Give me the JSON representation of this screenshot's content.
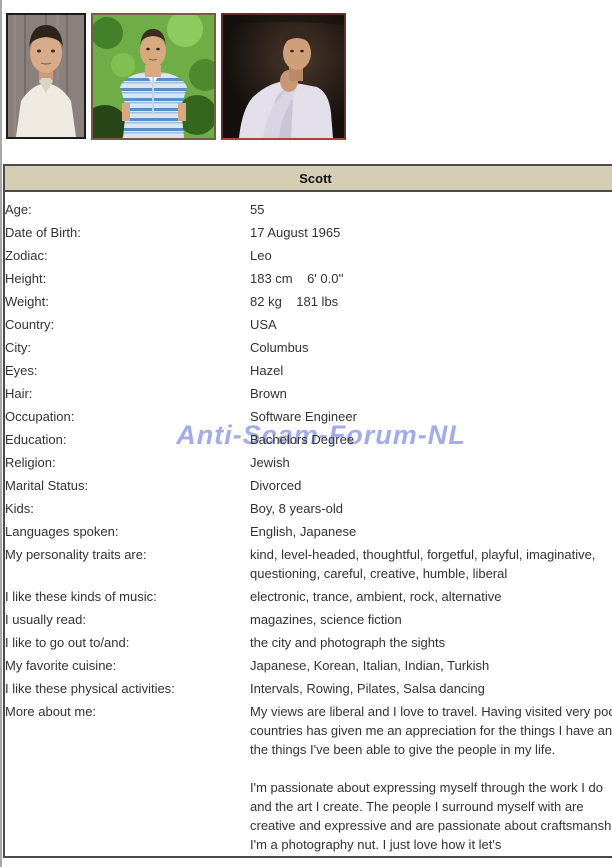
{
  "watermark": {
    "text": "Anti-Scam-Forum-NL",
    "color": "#98a4ea"
  },
  "photos": [
    {
      "name": "profile-photo-1",
      "description": "portrait, wood background, white shirt"
    },
    {
      "name": "profile-photo-2",
      "description": "man in blue striped polo, green foliage"
    },
    {
      "name": "profile-photo-3",
      "description": "man in white shirt, dark background, hand on chin"
    }
  ],
  "profile": {
    "name": "Scott",
    "rows": [
      {
        "label": "Age:",
        "value": "55"
      },
      {
        "label": "Date of Birth:",
        "value": "17 August 1965"
      },
      {
        "label": "Zodiac:",
        "value": "Leo"
      },
      {
        "label": "Height:",
        "value": "183 cm    6' 0.0''"
      },
      {
        "label": "Weight:",
        "value": "82 kg    181 lbs"
      },
      {
        "label": "Country:",
        "value": "USA"
      },
      {
        "label": "City:",
        "value": "Columbus"
      },
      {
        "label": "Eyes:",
        "value": "Hazel"
      },
      {
        "label": "Hair:",
        "value": "Brown"
      },
      {
        "label": "Occupation:",
        "value": "Software Engineer"
      },
      {
        "label": "Education:",
        "value": "Bachelors Degree"
      },
      {
        "label": "Religion:",
        "value": "Jewish"
      },
      {
        "label": "Marital Status:",
        "value": "Divorced"
      },
      {
        "label": "Kids:",
        "value": "Boy, 8 years-old"
      },
      {
        "label": "Languages spoken:",
        "value": "English, Japanese"
      },
      {
        "label": "My personality traits are:",
        "value": "kind, level-headed, thoughtful, forgetful, playful, imaginative, questioning, careful, creative, humble, liberal"
      },
      {
        "label": "I like these kinds of music:",
        "value": "electronic, trance, ambient, rock, alternative"
      },
      {
        "label": "I usually read:",
        "value": "magazines, science fiction"
      },
      {
        "label": "I like to go out to/and:",
        "value": "the city and photograph the sights"
      },
      {
        "label": "My favorite cuisine:",
        "value": "Japanese, Korean, Italian, Indian, Turkish"
      },
      {
        "label": "I like these physical activities:",
        "value": "Intervals, Rowing, Pilates, Salsa dancing"
      },
      {
        "label": "More about me:",
        "value": "My views are liberal and I love to travel. Having visited very poor countries has given me an appreciation for the things I have and the things I've been able to give the people in my life.\n\nI'm passionate about expressing myself through the work I do and the art I create. The people I surround myself with are creative and expressive and are passionate about craftsmanship. I'm a photography nut. I just love how it let's"
      }
    ]
  },
  "colors": {
    "header_bg": "#d5ceb5",
    "table_border": "#4b4b4b",
    "text": "#333333",
    "watermark": "#98a4ea"
  }
}
